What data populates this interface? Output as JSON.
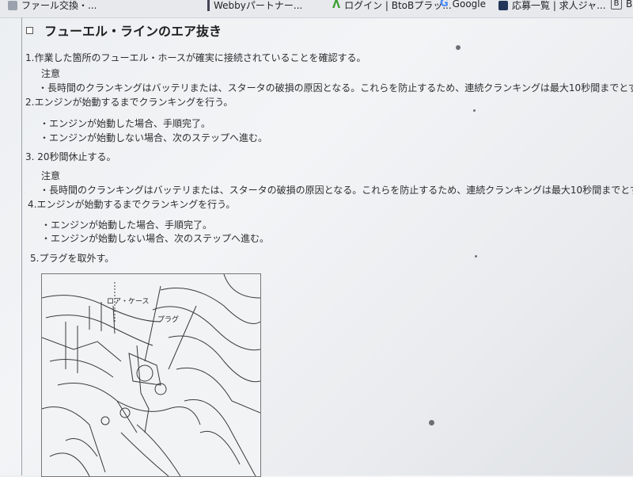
{
  "bookmarks": [
    {
      "label": "ファール交換・...",
      "icon": "generic-icon"
    },
    {
      "label": "Webbyパートナー...",
      "icon": "bar-icon"
    },
    {
      "label": "ログイン | BtoBプラッ...",
      "icon": "x-icon"
    },
    {
      "label": "Google",
      "icon": "google-icon"
    },
    {
      "label": "応募一覧 | 求人ジャ...",
      "icon": "book-icon"
    },
    {
      "label": "B",
      "icon": "b-icon"
    }
  ],
  "page": {
    "title": "フューエル・ラインのエア抜き",
    "step1": "1.作業した箇所のフューエル・ホースが確実に接続されていることを確認する。",
    "note1_label": "注意",
    "note1_text": "・長時間のクランキングはバッテリまたは、スタータの破損の原因となる。これらを防止するため、連続クランキングは最大10秒間までとす",
    "step2": "2.エンジンが始動するまでクランキングを行う。",
    "step2_b1": "・エンジンが始動した場合、手順完了。",
    "step2_b2": "・エンジンが始動しない場合、次のステップへ進む。",
    "step3": "3. 20秒間休止する。",
    "note2_label": "注意",
    "note2_text": "・長時間のクランキングはバッテリまたは、スタータの破損の原因となる。これらを防止するため、連続クランキングは最大10秒間までとす",
    "step4": "4.エンジンが始動するまでクランキングを行う。",
    "step4_b1": "・エンジンが始動した場合、手順完了。",
    "step4_b2": "・エンジンが始動しない場合、次のステップへ進む。",
    "step5": "5.プラグを取外す。",
    "figure": {
      "label_lower_case": "ロア・ケース",
      "label_plug": "プラグ"
    }
  }
}
